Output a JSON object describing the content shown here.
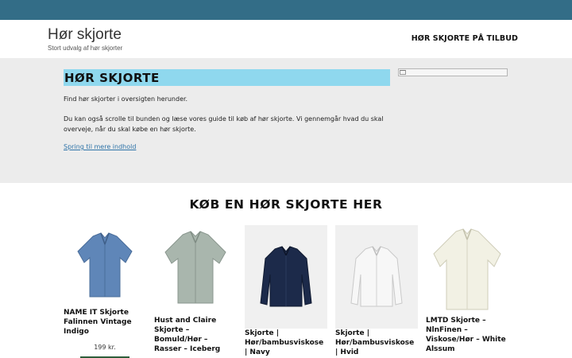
{
  "header": {
    "site_title": "Hør skjorte",
    "tagline": "Stort udvalg af hør skjorter",
    "nav_link": "HØR SKJORTE PÅ TILBUD"
  },
  "hero": {
    "title": "HØR SKJORTE",
    "paragraph_1": "Find hør skjorter i oversigten herunder.",
    "paragraph_2": "Du kan også scrolle til bunden og læse vores guide til køb af hør skjorte. Vi gennemgår hvad du skal overveje, når du skal købe en hør skjorte.",
    "link": "Spring til mere indhold"
  },
  "products_section": {
    "title": "KØB EN HØR SKJORTE HER",
    "products": [
      {
        "name": "NAME IT Skjorte Falinnen Vintage Indigo",
        "price": "199 kr.",
        "icon": "shirt-blue-short-sleeve-icon",
        "color": "#5f86b8"
      },
      {
        "name": "Hust and Claire Skjorte – Bomuld/Hør – Rasser – Iceberg",
        "icon": "shirt-green-short-sleeve-icon",
        "color": "#a9b6ad"
      },
      {
        "name": "Skjorte | Hør/bambusviskose | Navy",
        "icon": "shirt-navy-long-sleeve-icon",
        "color": "#1c2a4a"
      },
      {
        "name": "Skjorte | Hør/bambusviskose | Hvid",
        "icon": "shirt-white-long-sleeve-icon",
        "color": "#f4f4f4"
      },
      {
        "name": "LMTD Skjorte – NlnFinen – Viskose/Hør – White Alssum",
        "icon": "shirt-cream-short-sleeve-icon",
        "color": "#f2f1e4"
      }
    ]
  },
  "colors": {
    "topbar": "#336d87",
    "hero_background": "#ececec",
    "hero_title_highlight": "#8fd8ee",
    "link": "#2f74a8",
    "buy_button": "#2e5e3a"
  }
}
